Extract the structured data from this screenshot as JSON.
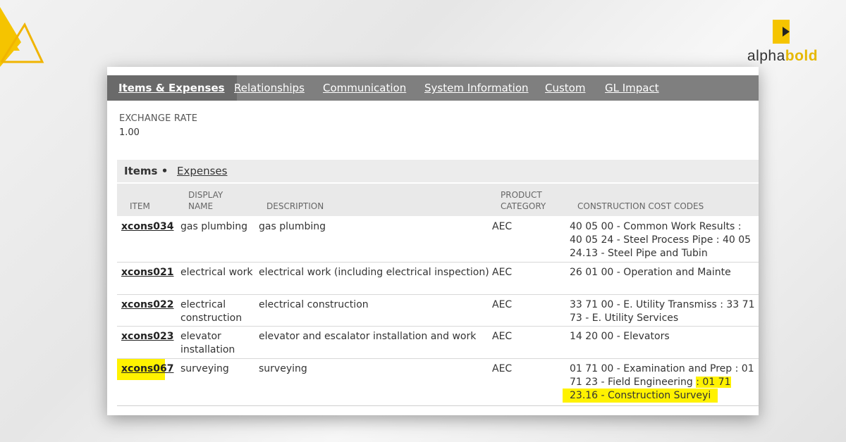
{
  "brand": {
    "part1": "alpha",
    "part2": "bold"
  },
  "tabs": [
    {
      "label": "Items & Expenses"
    },
    {
      "label": "Relationships"
    },
    {
      "label": "Communication"
    },
    {
      "label": "System Information"
    },
    {
      "label": "Custom"
    },
    {
      "label": "GL Impact"
    }
  ],
  "exchange_rate": {
    "label": "EXCHANGE RATE",
    "value": "1.00"
  },
  "subtabs": [
    {
      "label": "Items •"
    },
    {
      "label": "Expenses"
    }
  ],
  "columns": {
    "item": "ITEM",
    "display_1": "DISPLAY",
    "display_2": "NAME",
    "description": "DESCRIPTION",
    "category_1": "PRODUCT",
    "category_2": "CATEGORY",
    "codes": "CONSTRUCTION COST CODES"
  },
  "rows": [
    {
      "item": "xcons034",
      "name_1": "gas plumbing",
      "name_2": "",
      "description": "gas plumbing",
      "category": "AEC",
      "codes_1": "40 05 00 - Common Work Results :",
      "codes_2": "40 05 24 - Steel Process Pipe : 40 05",
      "codes_3": "24.13 - Steel Pipe and Tubin"
    },
    {
      "item": "xcons021",
      "name_1": "electrical work",
      "name_2": "",
      "description": "electrical work (including electrical inspection)",
      "category": "AEC",
      "codes_1": "26 01 00 - Operation and Mainte",
      "codes_2": "",
      "codes_3": ""
    },
    {
      "item": "xcons022",
      "name_1": "electrical",
      "name_2": "construction",
      "description": "electrical construction",
      "category": "AEC",
      "codes_1": "33 71 00 - E. Utility Transmiss : 33 71",
      "codes_2": "73 - E. Utility Services",
      "codes_3": ""
    },
    {
      "item": "xcons023",
      "name_1": "elevator",
      "name_2": "installation",
      "description": "elevator and escalator installation and work",
      "category": "AEC",
      "codes_1": "14 20 00 - Elevators",
      "codes_2": "",
      "codes_3": ""
    },
    {
      "item": "xcons067",
      "name_1": "surveying",
      "name_2": "",
      "description": "surveying",
      "category": "AEC",
      "codes_1": "01 71 00 - Examination and Prep : 01",
      "codes_2a": "71 23 - Field Engineering ",
      "codes_2b": ": 01 71",
      "codes_3": "23.16 - Construction Surveyi"
    }
  ],
  "colors": {
    "highlight": "#fff200",
    "tabbar": "#7f7f7f",
    "brand_accent": "#e6b800"
  }
}
